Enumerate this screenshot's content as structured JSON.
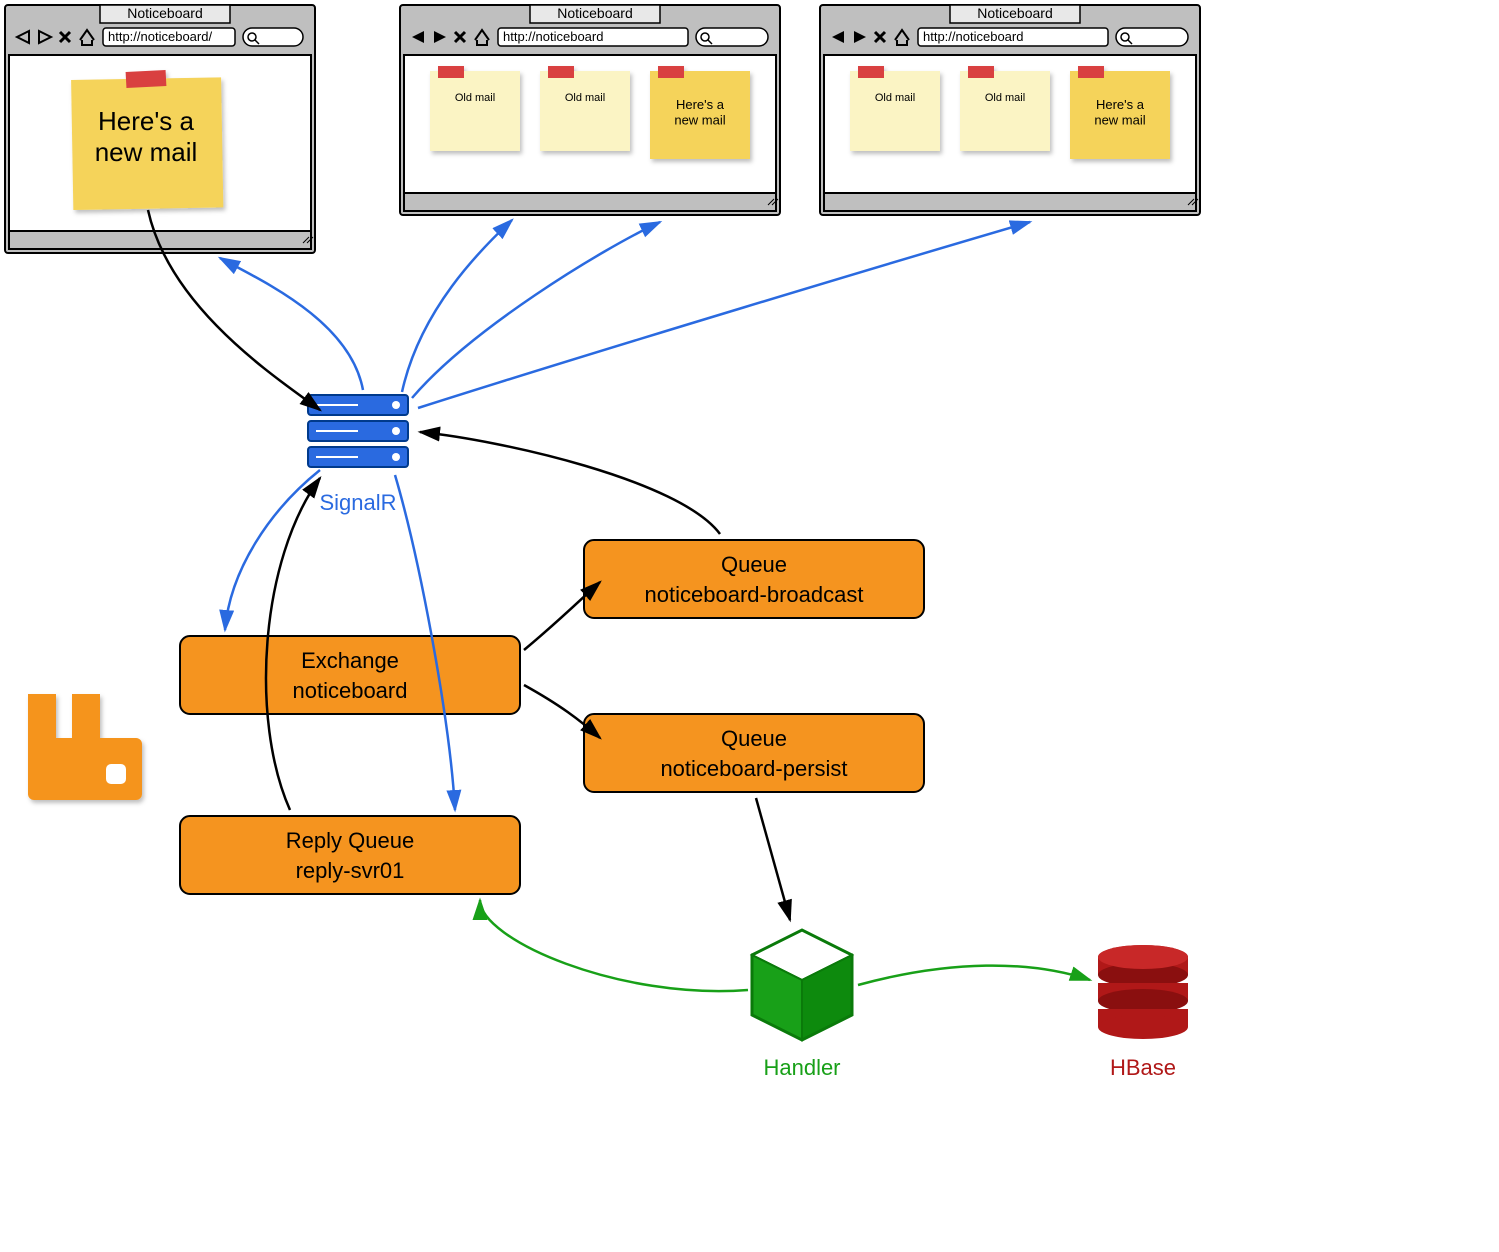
{
  "browsers": {
    "title": "Noticeboard",
    "url": "http://noticeboard/",
    "url2": "http://noticeboard",
    "note_new": "Here's a\nnew mail",
    "note_old": "Old mail"
  },
  "components": {
    "signalr": "SignalR",
    "exchange_t": "Exchange",
    "exchange_b": "noticeboard",
    "queue1_t": "Queue",
    "queue1_b": "noticeboard-broadcast",
    "queue2_t": "Queue",
    "queue2_b": "noticeboard-persist",
    "reply_t": "Reply Queue",
    "reply_b": "reply-svr01",
    "handler": "Handler",
    "hbase": "HBase"
  }
}
